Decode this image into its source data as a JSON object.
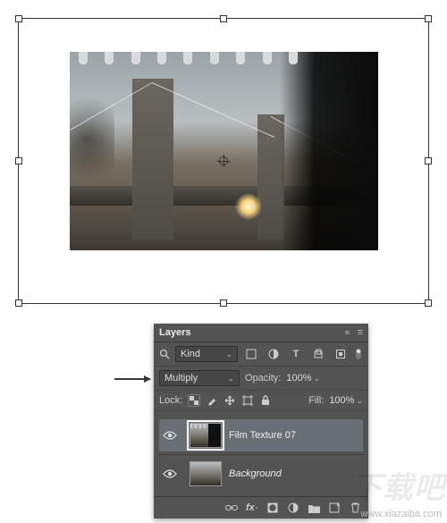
{
  "panel": {
    "title": "Layers",
    "filter": {
      "kind_label": "Kind"
    },
    "blend_row": {
      "mode": "Multiply",
      "opacity_label": "Opacity:",
      "opacity_value": "100%"
    },
    "lock_row": {
      "label": "Lock:",
      "fill_label": "Fill:",
      "fill_value": "100%"
    },
    "layers": [
      {
        "name": "Film Texture 07",
        "selected": true,
        "italic": false
      },
      {
        "name": "Background",
        "selected": false,
        "italic": true
      }
    ]
  },
  "watermark": {
    "logo": "下载吧",
    "url": "www.xiazaiba.com"
  }
}
